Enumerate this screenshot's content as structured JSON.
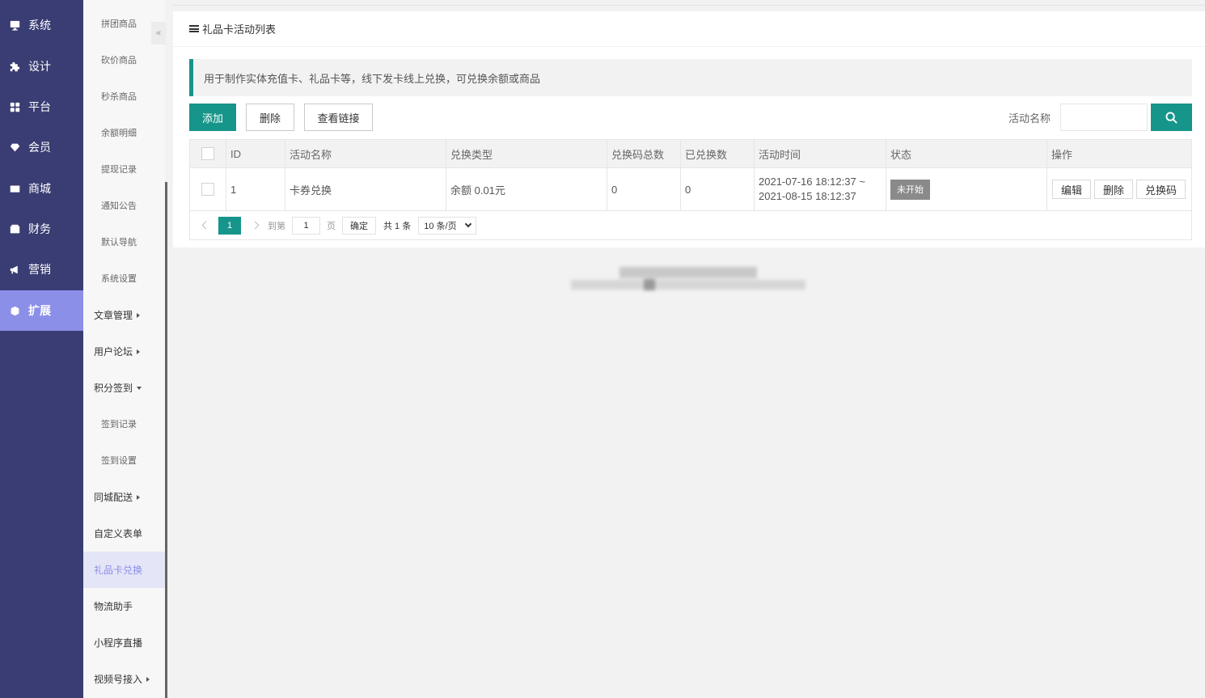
{
  "nav_primary": [
    {
      "label": "系统",
      "icon": "monitor-icon"
    },
    {
      "label": "设计",
      "icon": "puzzle-icon"
    },
    {
      "label": "平台",
      "icon": "grid-icon"
    },
    {
      "label": "会员",
      "icon": "diamond-icon"
    },
    {
      "label": "商城",
      "icon": "envelope-icon"
    },
    {
      "label": "财务",
      "icon": "wallet-icon"
    },
    {
      "label": "营销",
      "icon": "megaphone-icon"
    },
    {
      "label": "扩展",
      "icon": "cube-icon",
      "active": true
    }
  ],
  "nav_secondary": [
    {
      "label": "拼团商品",
      "type": "sub"
    },
    {
      "label": "砍价商品",
      "type": "sub"
    },
    {
      "label": "秒杀商品",
      "type": "sub"
    },
    {
      "label": "余额明细",
      "type": "sub"
    },
    {
      "label": "提现记录",
      "type": "sub"
    },
    {
      "label": "通知公告",
      "type": "sub"
    },
    {
      "label": "默认导航",
      "type": "sub"
    },
    {
      "label": "系统设置",
      "type": "sub"
    },
    {
      "label": "文章管理",
      "type": "top",
      "caret": "right"
    },
    {
      "label": "用户论坛",
      "type": "top",
      "caret": "right"
    },
    {
      "label": "积分签到",
      "type": "top",
      "caret": "down"
    },
    {
      "label": "签到记录",
      "type": "sub"
    },
    {
      "label": "签到设置",
      "type": "sub"
    },
    {
      "label": "同城配送",
      "type": "top",
      "caret": "right"
    },
    {
      "label": "自定义表单",
      "type": "top"
    },
    {
      "label": "礼品卡兑换",
      "type": "top",
      "active": true
    },
    {
      "label": "物流助手",
      "type": "top"
    },
    {
      "label": "小程序直播",
      "type": "top"
    },
    {
      "label": "视频号接入",
      "type": "top",
      "caret": "right"
    }
  ],
  "collapse_label": "«",
  "page": {
    "title": "礼品卡活动列表",
    "tip": "用于制作实体充值卡、礼品卡等，线下发卡线上兑换，可兑换余额或商品",
    "buttons": {
      "add": "添加",
      "delete": "删除",
      "view_link": "查看链接"
    },
    "search": {
      "label": "活动名称",
      "value": "",
      "placeholder": ""
    }
  },
  "table": {
    "columns": [
      "ID",
      "活动名称",
      "兑换类型",
      "兑换码总数",
      "已兑换数",
      "活动时间",
      "状态",
      "操作"
    ],
    "rows": [
      {
        "id": "1",
        "name": "卡券兑换",
        "type": "余额 0.01元",
        "total": "0",
        "redeemed": "0",
        "time_start": "2021-07-16 18:12:37 ~",
        "time_end": "2021-08-15 18:12:37",
        "status": "未开始",
        "actions": [
          "编辑",
          "删除",
          "兑换码"
        ]
      }
    ]
  },
  "pager": {
    "current": "1",
    "goto_label": "到第",
    "goto_value": "1",
    "page_label": "页",
    "ok_label": "确定",
    "total_label": "共 1 条",
    "per_page": "10 条/页"
  },
  "colors": {
    "primary": "#16958a",
    "nav_bg": "#393d73",
    "nav_active": "#8b8fe8"
  }
}
